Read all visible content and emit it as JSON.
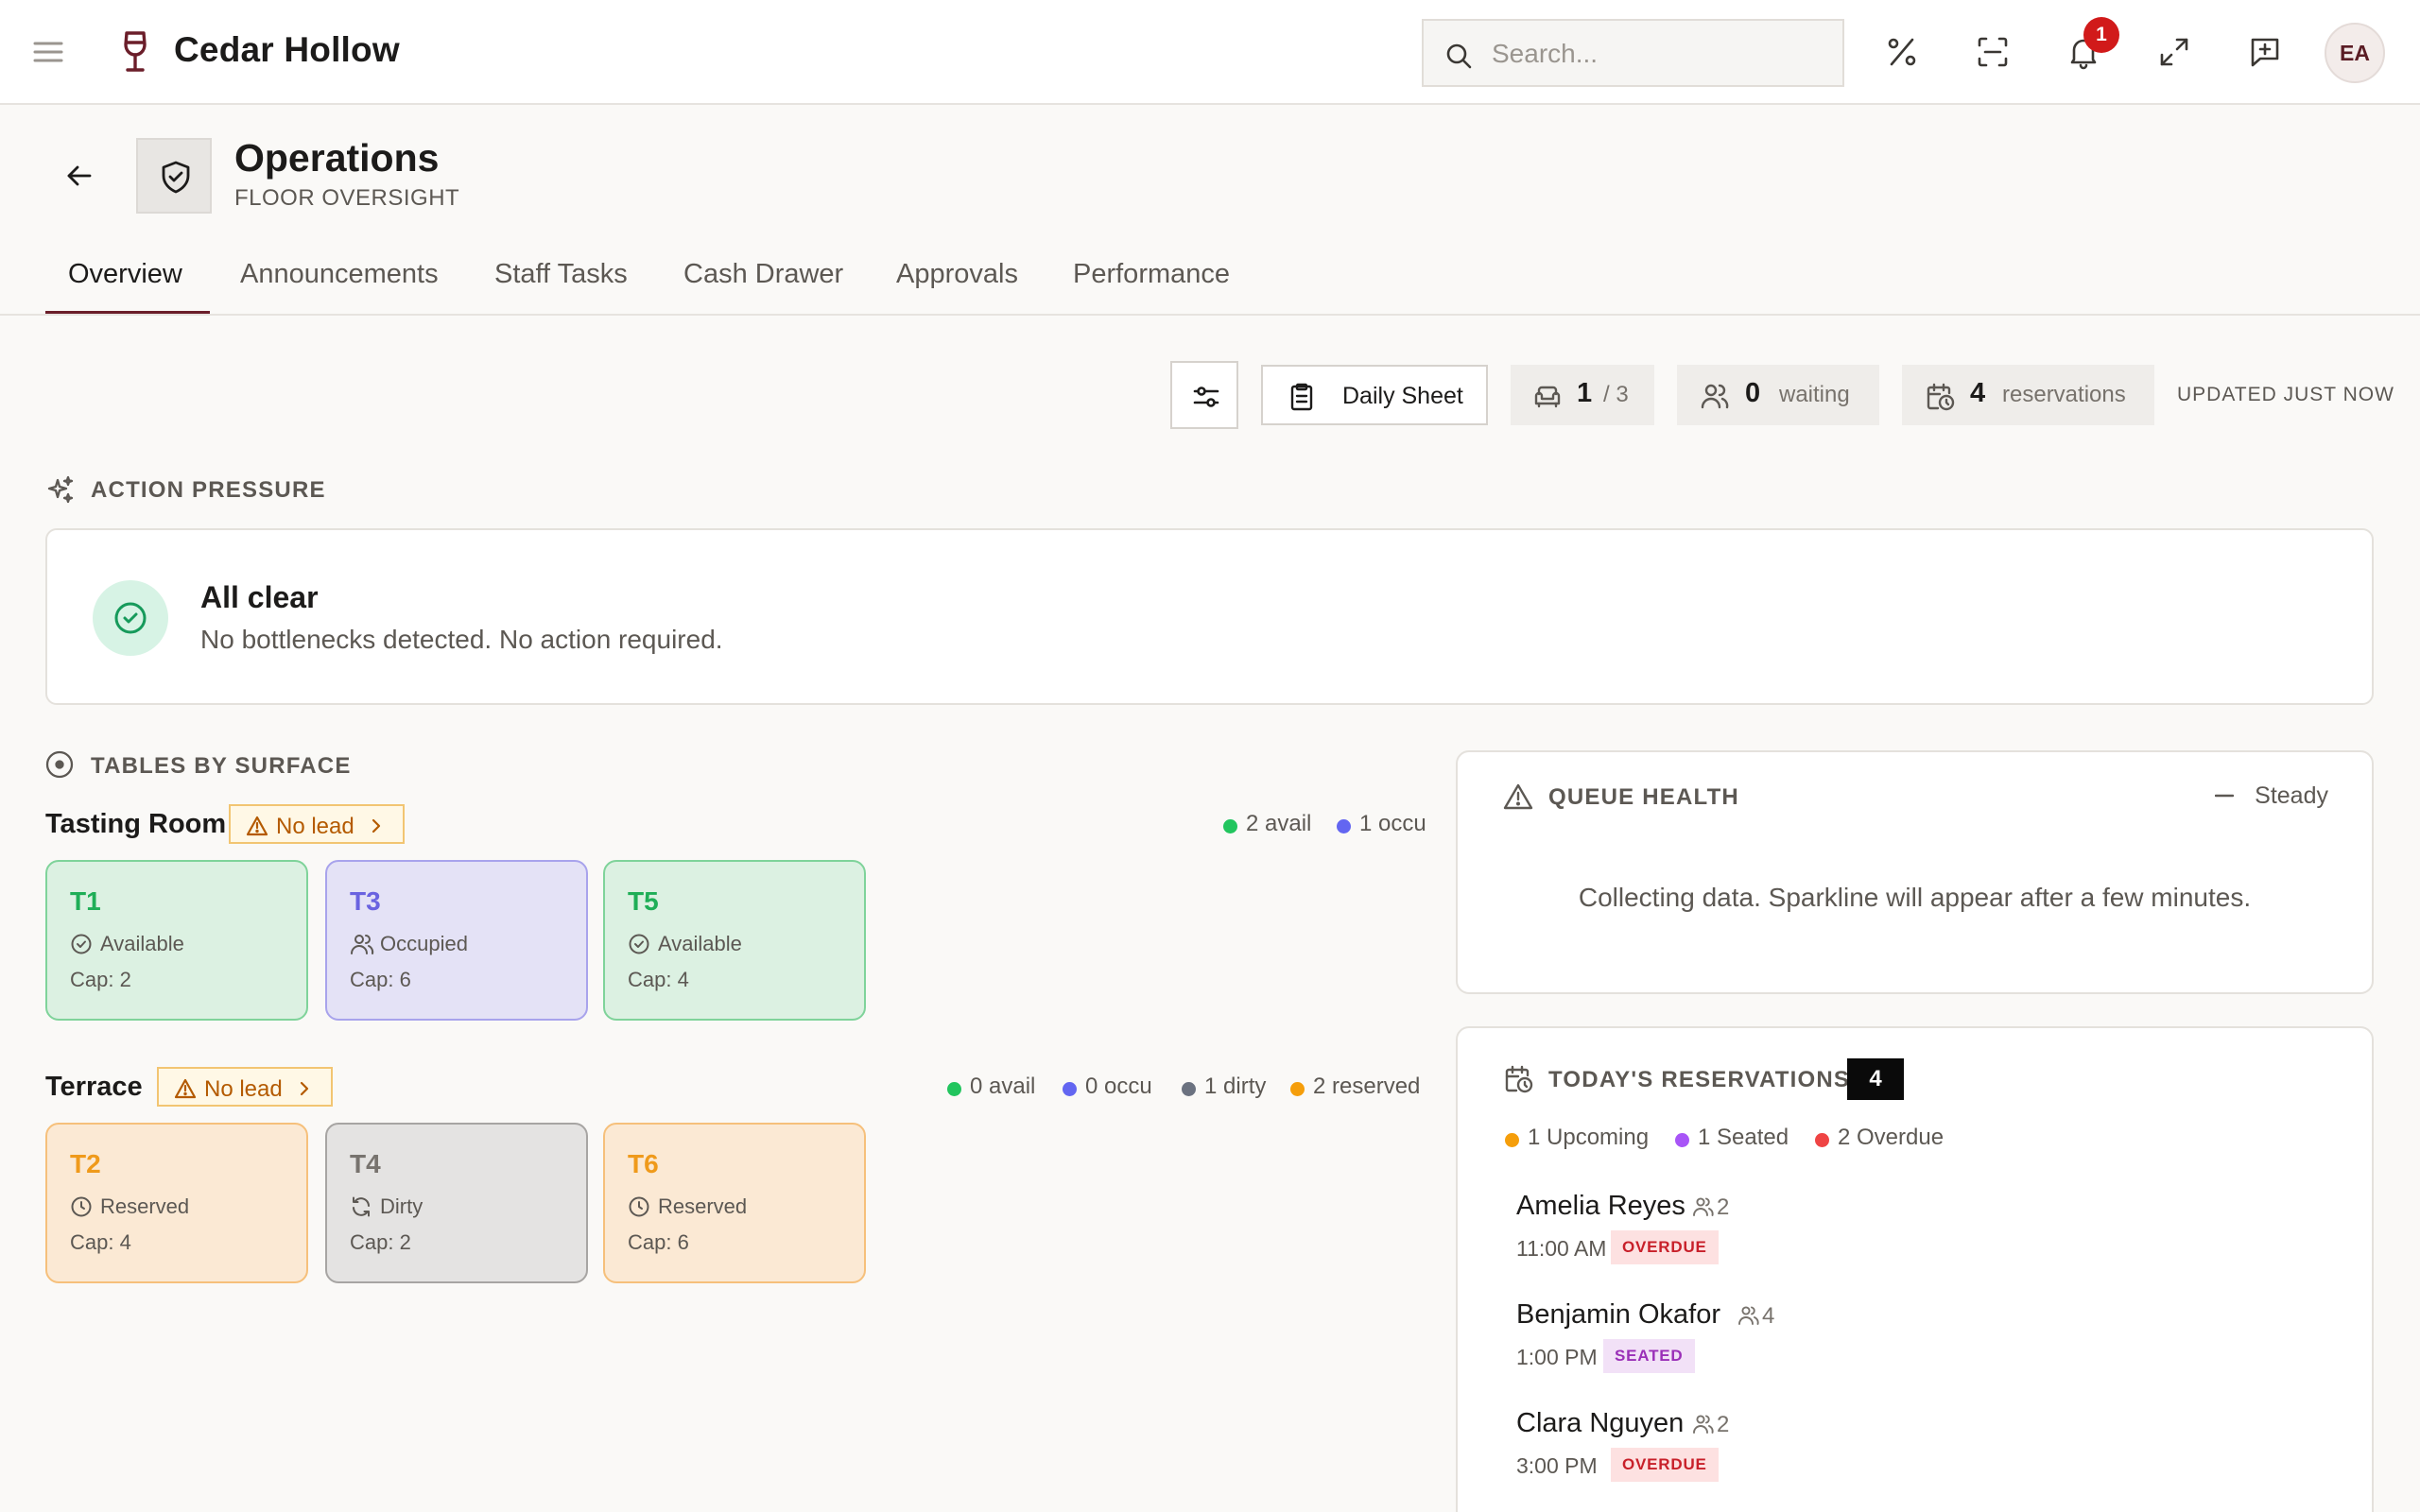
{
  "app": {
    "brand": "Cedar Hollow",
    "search_placeholder": "Search...",
    "notification_count": "1",
    "avatar_initials": "EA"
  },
  "header": {
    "title": "Operations",
    "subtitle": "FLOOR OVERSIGHT"
  },
  "tabs": [
    {
      "label": "Overview",
      "active": true
    },
    {
      "label": "Announcements"
    },
    {
      "label": "Staff Tasks"
    },
    {
      "label": "Cash Drawer"
    },
    {
      "label": "Approvals"
    },
    {
      "label": "Performance"
    }
  ],
  "stats": {
    "daily_sheet_label": "Daily Sheet",
    "seated": "1",
    "seated_total": "/ 3",
    "waiting_count": "0",
    "waiting_label": "waiting",
    "reservations_count": "4",
    "reservations_label": "reservations",
    "updated": "UPDATED JUST NOW"
  },
  "action_pressure": {
    "title": "ACTION PRESSURE",
    "status_title": "All clear",
    "status_text": "No bottlenecks detected. No action required."
  },
  "tables_section": {
    "title": "TABLES BY SURFACE",
    "no_lead_label": "No lead",
    "surfaces": [
      {
        "name": "Tasting Room",
        "legend": [
          {
            "label": "2 avail",
            "color": "#22c55e"
          },
          {
            "label": "1 occu",
            "color": "#6366f1"
          }
        ],
        "tables": [
          {
            "id": "T1",
            "status": "Available",
            "cap": "Cap: 2",
            "kind": "avail"
          },
          {
            "id": "T3",
            "status": "Occupied",
            "cap": "Cap: 6",
            "kind": "occ"
          },
          {
            "id": "T5",
            "status": "Available",
            "cap": "Cap: 4",
            "kind": "avail"
          }
        ]
      },
      {
        "name": "Terrace",
        "legend": [
          {
            "label": "0 avail",
            "color": "#22c55e"
          },
          {
            "label": "0 occu",
            "color": "#6366f1"
          },
          {
            "label": "1 dirty",
            "color": "#6b7280"
          },
          {
            "label": "2 reserved",
            "color": "#f59e0b"
          }
        ],
        "tables": [
          {
            "id": "T2",
            "status": "Reserved",
            "cap": "Cap: 4",
            "kind": "res"
          },
          {
            "id": "T4",
            "status": "Dirty",
            "cap": "Cap: 2",
            "kind": "dirty"
          },
          {
            "id": "T6",
            "status": "Reserved",
            "cap": "Cap: 6",
            "kind": "res"
          }
        ]
      }
    ]
  },
  "queue_health": {
    "title": "QUEUE HEALTH",
    "trend": "Steady",
    "message": "Collecting data. Sparkline will appear after a few minutes."
  },
  "reservations": {
    "title": "TODAY'S RESERVATIONS",
    "count": "4",
    "legend": [
      {
        "label": "1 Upcoming",
        "color": "#f59e0b"
      },
      {
        "label": "1 Seated",
        "color": "#a855f7"
      },
      {
        "label": "2 Overdue",
        "color": "#ef4444"
      }
    ],
    "items": [
      {
        "name": "Amelia Reyes",
        "party": "2",
        "time": "11:00 AM",
        "badge": "OVERDUE",
        "kind": "overdue"
      },
      {
        "name": "Benjamin Okafor",
        "party": "4",
        "time": "1:00 PM",
        "badge": "SEATED",
        "kind": "seated"
      },
      {
        "name": "Clara Nguyen",
        "party": "2",
        "time": "3:00 PM",
        "badge": "OVERDUE",
        "kind": "overdue"
      }
    ]
  }
}
